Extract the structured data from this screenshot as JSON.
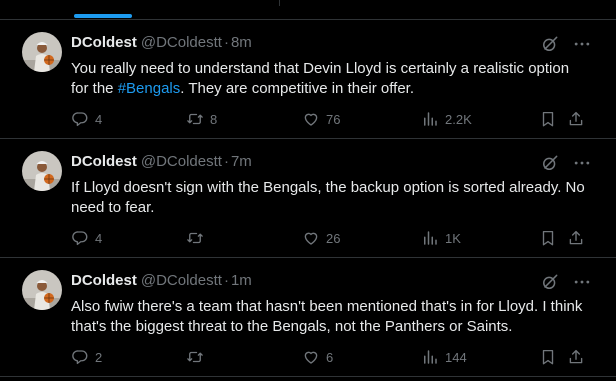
{
  "tweets": [
    {
      "name": "DColdest",
      "handle": "@DColdestt",
      "separator": "·",
      "time": "8m",
      "text_before": "You really need to understand that Devin Lloyd is certainly a realistic option for the ",
      "hashtag": "#Bengals",
      "text_after": ". They are competitive in their offer.",
      "replies": "4",
      "reposts": "8",
      "likes": "76",
      "views": "2.2K"
    },
    {
      "name": "DColdest",
      "handle": "@DColdestt",
      "separator": "·",
      "time": "7m",
      "text_before": "If Lloyd doesn't sign with the Bengals, the backup option is sorted already. No need to fear.",
      "hashtag": "",
      "text_after": "",
      "replies": "4",
      "reposts": "",
      "likes": "26",
      "views": "1K"
    },
    {
      "name": "DColdest",
      "handle": "@DColdestt",
      "separator": "·",
      "time": "1m",
      "text_before": "Also fwiw there's a team that hasn't been mentioned that's in for Lloyd. I think that's the biggest threat to the Bengals, not the Panthers or Saints.",
      "hashtag": "",
      "text_after": "",
      "replies": "2",
      "reposts": "",
      "likes": "6",
      "views": "144"
    }
  ],
  "icons": {
    "reply": "reply-icon",
    "repost": "repost-icon",
    "like": "heart-icon",
    "views": "views-chart-icon",
    "bookmark": "bookmark-icon",
    "share": "share-icon",
    "grok": "grok-icon",
    "more": "more-dots-icon"
  },
  "colors": {
    "background": "#000000",
    "text": "#e7e9ea",
    "muted": "#71767b",
    "accent": "#1d9bf0",
    "divider": "#2f3336"
  }
}
